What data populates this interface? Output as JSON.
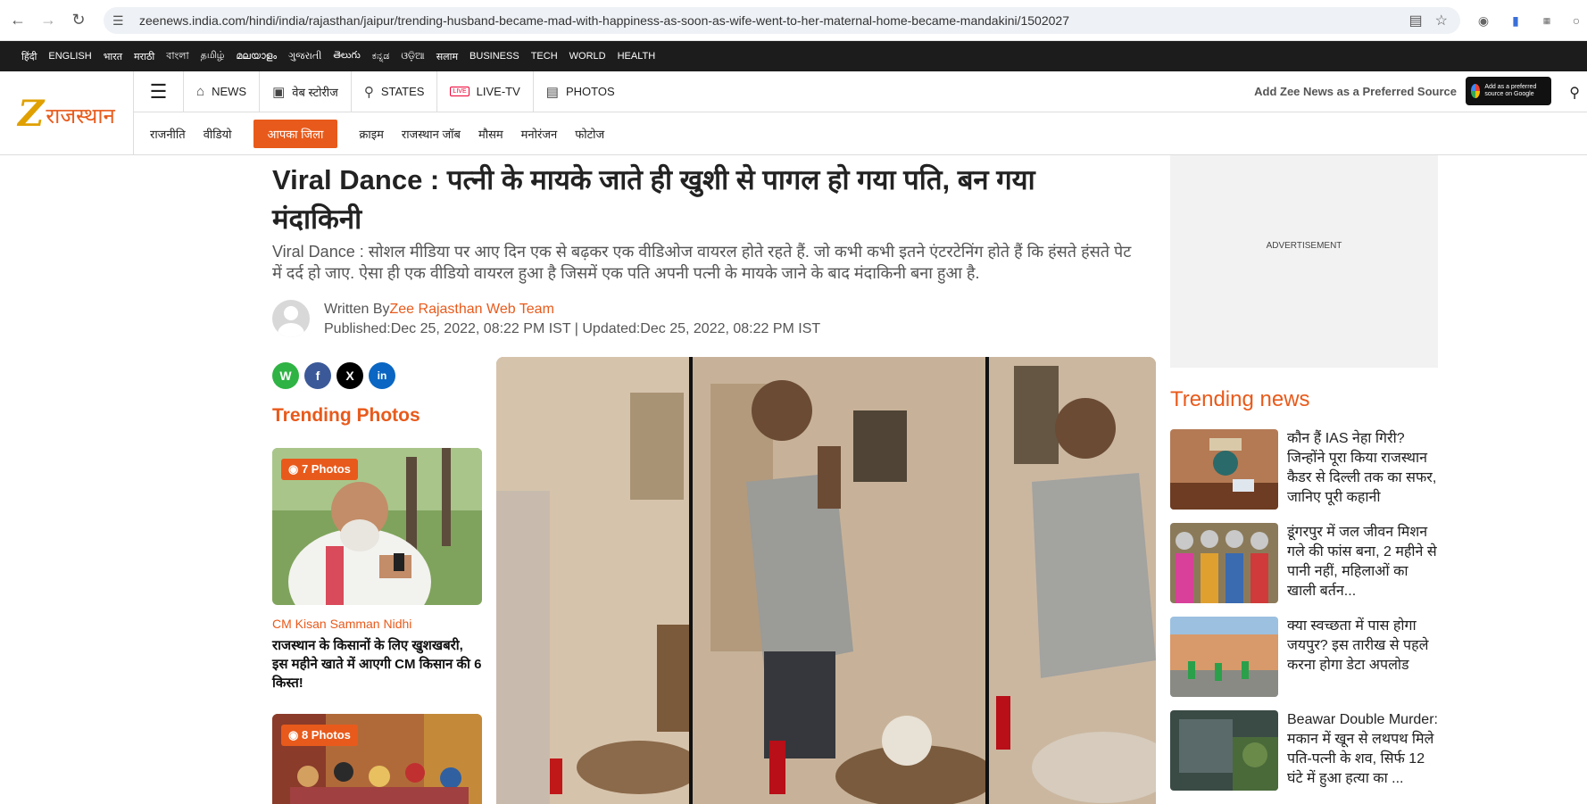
{
  "browser": {
    "url": "zeenews.india.com/hindi/india/rajasthan/jaipur/trending-husband-became-mad-with-happiness-as-soon-as-wife-went-to-her-maternal-home-became-mandakini/1502027"
  },
  "langbar": [
    "हिंदी",
    "ENGLISH",
    "भारत",
    "मराठी",
    "বাংলা",
    "தமிழ்",
    "മലയാളം",
    "ગુજરાતી",
    "తెలుగు",
    "ಕನ್ನಡ",
    "ଓଡ଼ିଆ",
    "सलाम",
    "BUSINESS",
    "TECH",
    "WORLD",
    "HEALTH"
  ],
  "header": {
    "logo_text": "राजस्थान",
    "logo_z": "Z",
    "nav": {
      "news": "NEWS",
      "webstories": "वेब स्टोरीज",
      "states": "STATES",
      "livetv": "LIVE-TV",
      "photos": "PHOTOS"
    },
    "preferred_text": "Add Zee News as a Preferred Source",
    "google_btn": "Add as a preferred source on Google",
    "subnav": [
      "राजनीति",
      "वीडियो",
      "आपका जिला",
      "क्राइम",
      "राजस्थान जॉब",
      "मौसम",
      "मनोरंजन",
      "फोटोज"
    ]
  },
  "article": {
    "headline": "Viral Dance : पत्नी के मायके जाते ही खुशी से पागल हो गया पति, बन गया मंदाकिनी",
    "summary": "Viral Dance : सोशल मीडिया पर आए दिन एक से बढ़कर एक वीडिओज वायरल होते रहते हैं. जो कभी कभी इतने एंटरटेनिंग होते हैं कि हंसते हंसते पेट में दर्द हो जाए. ऐसा ही एक वीडियो वायरल हुआ है जिसमें एक पति अपनी पत्नी के मायके जाने के बाद मंदाकिनी बना हुआ है.",
    "written_by_label": "Written By",
    "author": "Zee Rajasthan Web Team",
    "published": "Published:Dec 25, 2022, 08:22 PM IST | Updated:Dec 25, 2022, 08:22 PM IST"
  },
  "share": {
    "whatsapp": "W",
    "facebook": "f",
    "x": "X",
    "linkedin": "in"
  },
  "trending_photos": {
    "title": "Trending Photos",
    "cards": [
      {
        "badge": "7 Photos",
        "category": "CM Kisan Samman Nidhi",
        "headline": "राजस्थान के किसानों के लिए खुशखबरी, इस महीने खाते में आएगी CM किसान की 6 किस्त!"
      },
      {
        "badge": "8 Photos"
      }
    ]
  },
  "ad_label": "ADVERTISEMENT",
  "trending_news": {
    "title": "Trending news",
    "items": [
      "कौन हैं IAS नेहा गिरी? जिन्होंने पूरा किया राजस्थान कैडर से दिल्ली तक का सफर, जानिए पूरी कहानी",
      "डूंगरपुर में जल जीवन मिशन गले की फांस बना, 2 महीने से पानी नहीं, महिलाओं का खाली बर्तन...",
      "क्या स्वच्छता में पास होगा जयपुर? इस तारीख से पहले करना होगा डेटा अपलोड",
      "Beawar Double Murder: मकान में खून से लथपथ मिले पति-पत्नी के शव, सिर्फ 12 घंटे में हुआ हत्या का ..."
    ]
  }
}
